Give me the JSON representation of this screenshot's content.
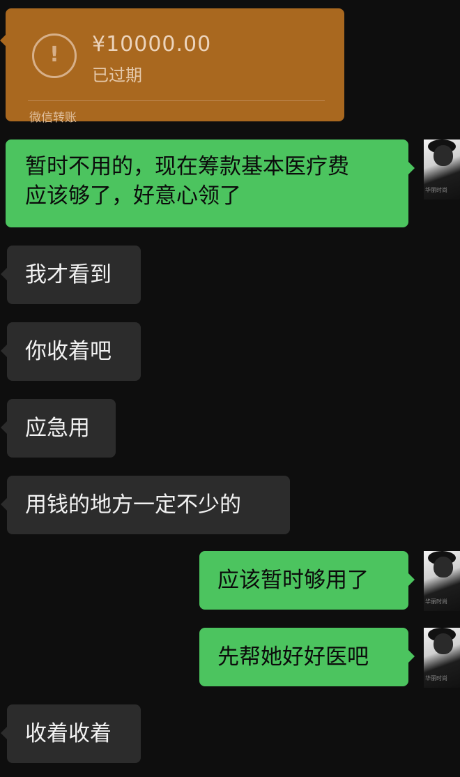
{
  "transfer": {
    "amount": "¥10000.00",
    "status": "已过期",
    "footer": "微信转账",
    "icon": "exclamation-circle-icon"
  },
  "messages": [
    {
      "side": "out",
      "text_line1": "暂时不用的，现在筹款基本医疗费",
      "text_line2": "应该够了，好意心领了"
    },
    {
      "side": "in",
      "text": "我才看到"
    },
    {
      "side": "in",
      "text": "你收着吧"
    },
    {
      "side": "in",
      "text": "应急用"
    },
    {
      "side": "in",
      "text": "用钱的地方一定不少的"
    },
    {
      "side": "out",
      "text": "应该暂时够用了"
    },
    {
      "side": "out",
      "text": "先帮她好好医吧"
    },
    {
      "side": "in",
      "text": "收着收着"
    }
  ],
  "avatar": {
    "caption": "华丽时尚"
  },
  "colors": {
    "background": "#0e0e0e",
    "transfer_card": "#a9681f",
    "outgoing_bubble": "#4cc45f",
    "incoming_bubble": "#2c2c2c"
  }
}
